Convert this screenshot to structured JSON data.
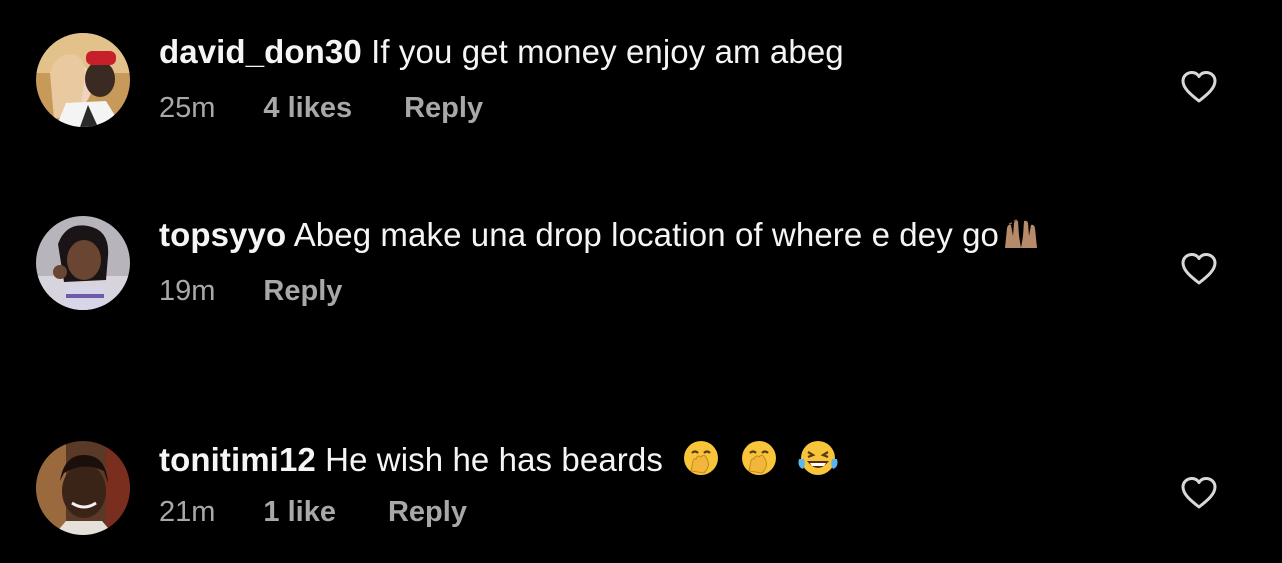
{
  "colors": {
    "background": "#000000",
    "text": "#f5f5f5",
    "meta": "#a8a8a8"
  },
  "comments": [
    {
      "username": "david_don30",
      "text": "If you get money enjoy am abeg",
      "time": "25m",
      "likes": "4 likes",
      "reply": "Reply",
      "emojis": []
    },
    {
      "username": "topsyyo",
      "text": "Abeg make una drop location of where e dey go",
      "time": "19m",
      "likes": "",
      "reply": "Reply",
      "emojis": [
        "raising-hands-emoji"
      ]
    },
    {
      "username": "tonitimi12",
      "text": "He wish he has beards",
      "time": "21m",
      "likes": "1 like",
      "reply": "Reply",
      "emojis": [
        "face-with-hand-over-mouth-emoji",
        "face-with-hand-over-mouth-emoji",
        "tears-of-joy-emoji"
      ]
    }
  ]
}
